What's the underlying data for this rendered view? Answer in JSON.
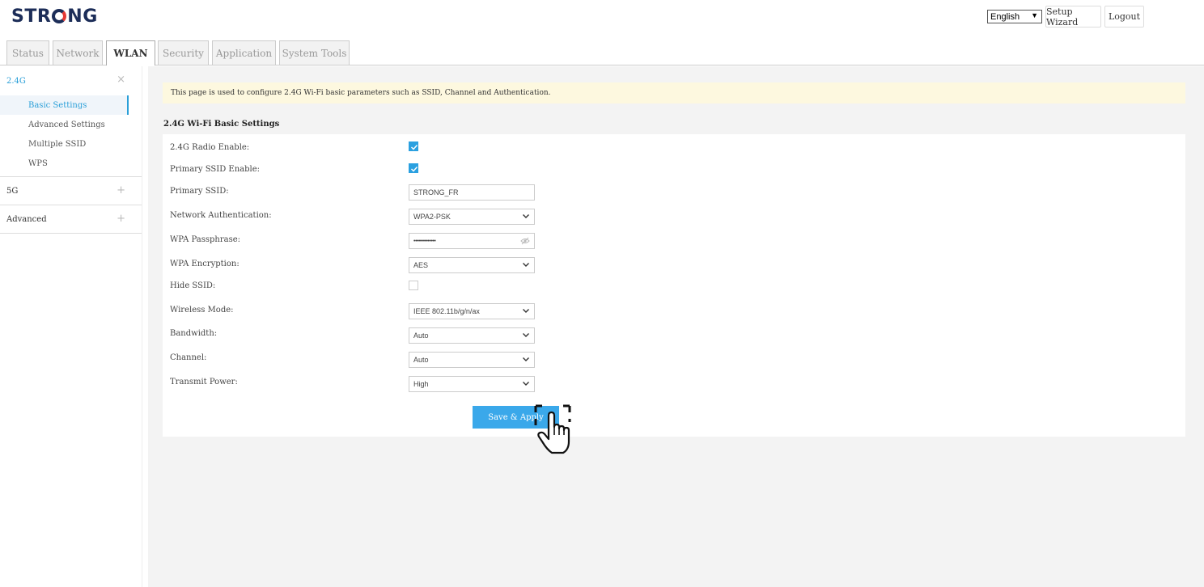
{
  "header": {
    "logo": "STRONG",
    "language": "English",
    "setup_wizard": "Setup Wizard",
    "logout": "Logout"
  },
  "tabs": [
    {
      "label": "Status",
      "active": false
    },
    {
      "label": "Network",
      "active": false
    },
    {
      "label": "WLAN",
      "active": true
    },
    {
      "label": "Security",
      "active": false
    },
    {
      "label": "Application",
      "active": false
    },
    {
      "label": "System Tools",
      "active": false
    }
  ],
  "sidebar": {
    "groups": [
      {
        "label": "2.4G",
        "toggle": "×",
        "items": [
          {
            "label": "Basic Settings",
            "active": true
          },
          {
            "label": "Advanced Settings",
            "active": false
          },
          {
            "label": "Multiple SSID",
            "active": false
          },
          {
            "label": "WPS",
            "active": false
          }
        ]
      },
      {
        "label": "5G",
        "toggle": "+"
      },
      {
        "label": "Advanced",
        "toggle": "+"
      }
    ]
  },
  "main": {
    "notice": "This page is used to configure 2.4G Wi-Fi basic parameters such as SSID, Channel and Authentication.",
    "section_title": "2.4G Wi-Fi Basic Settings",
    "fields": {
      "radio_enable": {
        "label": "2.4G Radio Enable:",
        "checked": true
      },
      "primary_ssid_enable": {
        "label": "Primary SSID Enable:",
        "checked": true
      },
      "primary_ssid": {
        "label": "Primary SSID:",
        "value": "STRONG_FR"
      },
      "auth": {
        "label": "Network Authentication:",
        "value": "WPA2-PSK"
      },
      "passphrase": {
        "label": "WPA Passphrase:",
        "value": "••••••••••••••"
      },
      "encryption": {
        "label": "WPA Encryption:",
        "value": "AES"
      },
      "hide_ssid": {
        "label": "Hide SSID:",
        "checked": false
      },
      "wireless_mode": {
        "label": "Wireless Mode:",
        "value": "IEEE 802.11b/g/n/ax"
      },
      "bandwidth": {
        "label": "Bandwidth:",
        "value": "Auto"
      },
      "channel": {
        "label": "Channel:",
        "value": "Auto"
      },
      "transmit_power": {
        "label": "Transmit Power:",
        "value": "High"
      }
    },
    "save_button": "Save & Apply"
  },
  "colors": {
    "accent": "#2a9fd8",
    "button": "#3aa8ea",
    "notice_bg": "#fdf8df",
    "logo": "#1c2d58"
  }
}
